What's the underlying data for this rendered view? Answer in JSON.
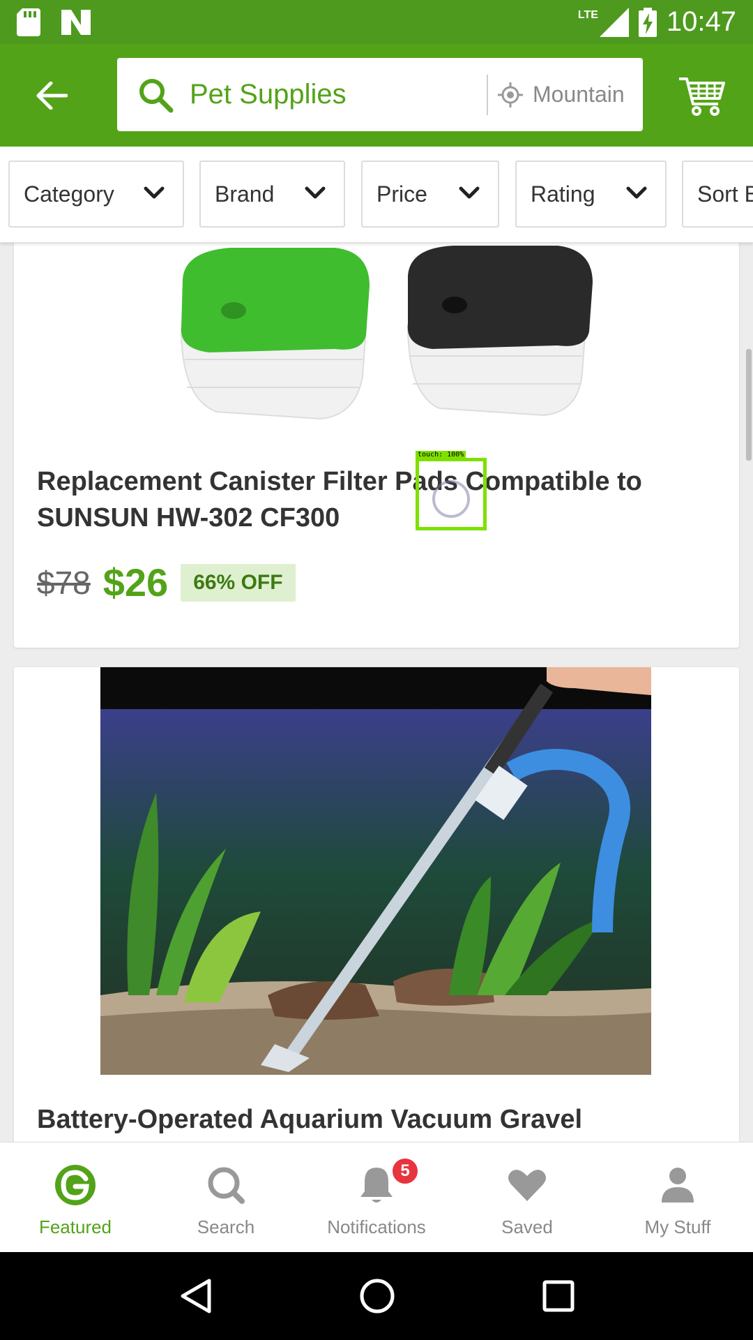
{
  "status_bar": {
    "network": "LTE",
    "time": "10:47",
    "icons": [
      "sd-card-icon",
      "n-logo-icon",
      "signal-icon",
      "battery-charging-icon"
    ]
  },
  "header": {
    "back_icon": "arrow-left-icon",
    "search_query": "Pet Supplies",
    "location": "Mountain",
    "cart_icon": "cart-icon"
  },
  "filters": [
    {
      "label": "Category"
    },
    {
      "label": "Brand"
    },
    {
      "label": "Price"
    },
    {
      "label": "Rating"
    },
    {
      "label": "Sort B"
    }
  ],
  "products": [
    {
      "title": "Replacement Canister Filter Pads Compatible to SUNSUN HW-302 CF300",
      "old_price": "$78",
      "price": "$26",
      "discount": "66% OFF"
    },
    {
      "title": "Battery-Operated Aquarium Vacuum Gravel"
    }
  ],
  "touch_overlay": {
    "label": "touch: 100%",
    "color": "#7fe000"
  },
  "bottom_nav": [
    {
      "label": "Featured",
      "icon": "groupon-g-icon",
      "active": true
    },
    {
      "label": "Search",
      "icon": "search-icon"
    },
    {
      "label": "Notifications",
      "icon": "bell-icon",
      "badge": "5"
    },
    {
      "label": "Saved",
      "icon": "heart-icon"
    },
    {
      "label": "My Stuff",
      "icon": "person-icon"
    }
  ],
  "colors": {
    "brand_green": "#53a318",
    "status_green": "#4e9a1e",
    "badge_red": "#e8343f"
  }
}
